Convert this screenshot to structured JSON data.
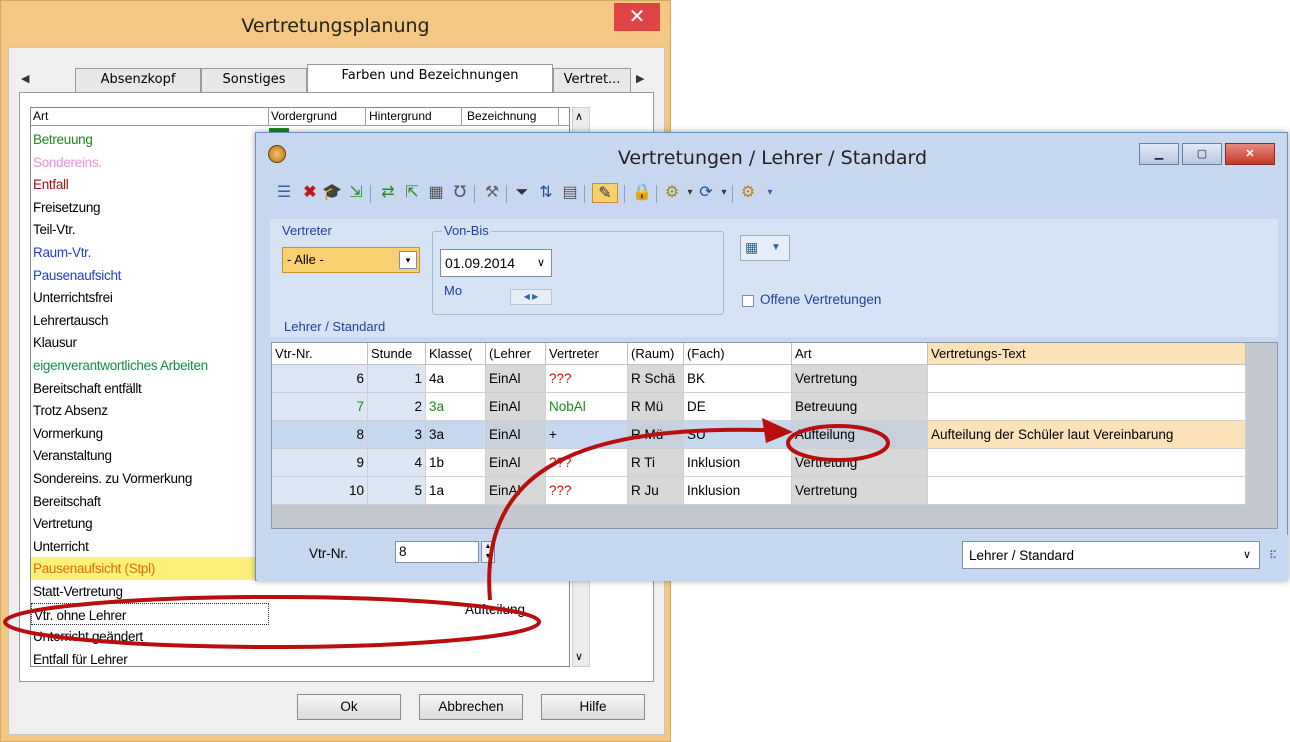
{
  "dialog1": {
    "title": "Vertretungsplanung",
    "close_glyph": "✕",
    "tabs": [
      "Absenzkopf",
      "Sonstiges",
      "Farben und Bezeichnungen",
      "Vertret..."
    ],
    "columns": [
      "Art",
      "Vordergrund",
      "Hintergrund",
      "Bezeichnung"
    ],
    "rows": [
      {
        "label": "Betreuung",
        "color": "#1a8a1a"
      },
      {
        "label": "Sondereins.",
        "color": "#f08fd8"
      },
      {
        "label": "Entfall",
        "color": "#9b1010"
      },
      {
        "label": "Freisetzung",
        "color": "#000000"
      },
      {
        "label": "Teil-Vtr.",
        "color": "#000000"
      },
      {
        "label": "Raum-Vtr.",
        "color": "#1f3fcc"
      },
      {
        "label": "Pausenaufsicht",
        "color": "#1f3fcc"
      },
      {
        "label": "Unterrichtsfrei",
        "color": "#000000"
      },
      {
        "label": "Lehrertausch",
        "color": "#000000"
      },
      {
        "label": "Klausur",
        "color": "#000000"
      },
      {
        "label": "eigenverantwortliches Arbeiten",
        "color": "#1a8a4a"
      },
      {
        "label": "Bereitschaft entfällt",
        "color": "#000000"
      },
      {
        "label": "Trotz Absenz",
        "color": "#000000"
      },
      {
        "label": "Vormerkung",
        "color": "#000000"
      },
      {
        "label": "Veranstaltung",
        "color": "#000000"
      },
      {
        "label": "Sondereins. zu Vormerkung",
        "color": "#000000"
      },
      {
        "label": "Bereitschaft",
        "color": "#000000"
      },
      {
        "label": "Vertretung",
        "color": "#000000"
      },
      {
        "label": "Unterricht",
        "color": "#000000"
      },
      {
        "label": "Pausenaufsicht (Stpl)",
        "color": "#e07000"
      },
      {
        "label": "Statt-Vertretung",
        "color": "#000000"
      },
      {
        "label": "Vtr. ohne Lehrer",
        "color": "#000000"
      },
      {
        "label": "Unterricht geändert",
        "color": "#000000"
      },
      {
        "label": "Entfall für Lehrer",
        "color": "#000000"
      }
    ],
    "selected_bezeichnung": "Aufteilung",
    "buttons": {
      "ok": "Ok",
      "cancel": "Abbrechen",
      "help": "Hilfe"
    }
  },
  "window2": {
    "title": "Vertretungen / Lehrer / Standard",
    "filters": {
      "vertreter_label": "Vertreter",
      "vertreter_value": "- Alle -",
      "vonbis_label": "Von-Bis",
      "date_value": "01.09.2014",
      "weekday": "Mo",
      "offene_label": "Offene Vertretungen",
      "view_label": "Lehrer / Standard"
    },
    "grid": {
      "columns": [
        "Vtr-Nr.",
        "Stunde",
        "Klasse(",
        "(Lehrer",
        "Vertreter",
        "(Raum)",
        "(Fach)",
        "Art",
        "Vertretungs-Text"
      ],
      "rows": [
        {
          "nr": "6",
          "stunde": "1",
          "klasse": "4a",
          "lehrer": "EinAl",
          "vertreter": "???",
          "raum": "R Schä",
          "fach": "BK",
          "art": "Vertretung",
          "text": ""
        },
        {
          "nr": "7",
          "stunde": "2",
          "klasse": "3a",
          "lehrer": "EinAl",
          "vertreter": "NobAl",
          "raum": "R Mü",
          "fach": "DE",
          "art": "Betreuung",
          "text": ""
        },
        {
          "nr": "8",
          "stunde": "3",
          "klasse": "3a",
          "lehrer": "EinAl",
          "vertreter": "+",
          "raum": "R Mü",
          "fach": "SU",
          "art": "Aufteilung",
          "text": "Aufteilung der Schüler laut Vereinbarung"
        },
        {
          "nr": "9",
          "stunde": "4",
          "klasse": "1b",
          "lehrer": "EinAl",
          "vertreter": "???",
          "raum": "R Ti",
          "fach": "Inklusion",
          "art": "Vertretung",
          "text": ""
        },
        {
          "nr": "10",
          "stunde": "5",
          "klasse": "1a",
          "lehrer": "EinAl",
          "vertreter": "???",
          "raum": "R Ju",
          "fach": "Inklusion",
          "art": "Vertretung",
          "text": ""
        }
      ]
    },
    "status": {
      "vtrnr_label": "Vtr-Nr.",
      "vtrnr_value": "8",
      "view_select": "Lehrer / Standard"
    }
  },
  "colors": {
    "accent_orange": "#f3c882",
    "window_blue": "#c7d7f0",
    "highlight_red": "#c01818",
    "selected_row": "#c6d8f0"
  }
}
